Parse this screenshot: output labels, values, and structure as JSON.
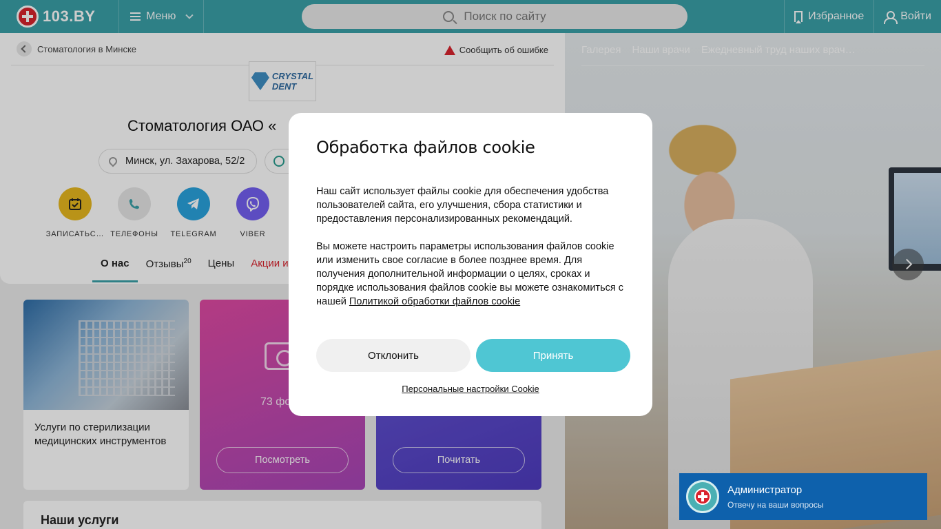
{
  "header": {
    "logo_text": "103.BY",
    "menu_label": "Меню",
    "search_placeholder": "Поиск по сайту",
    "favorites_label": "Избранное",
    "login_label": "Войти"
  },
  "breadcrumb": {
    "label": "Стоматология в Минске"
  },
  "report_error": {
    "label": "Сообщить об ошибке"
  },
  "clinic": {
    "logo_line1": "CRYSTAL",
    "logo_line2": "DENT",
    "title": "Стоматология ОАО «",
    "address": "Минск, ул. Захарова, 52/2"
  },
  "actions": [
    {
      "label": "ЗАПИСАТЬС…",
      "icon": "calendar-icon",
      "color": "#e8b81e"
    },
    {
      "label": "ТЕЛЕФОНЫ",
      "icon": "phone-icon",
      "color": "#e6e6e6"
    },
    {
      "label": "TELEGRAM",
      "icon": "telegram-icon",
      "color": "#2aa3de"
    },
    {
      "label": "VIBER",
      "icon": "viber-icon",
      "color": "#7360f2"
    }
  ],
  "tabs": [
    {
      "label": "О нас"
    },
    {
      "label": "Отзывы",
      "count": "20"
    },
    {
      "label": "Цены"
    },
    {
      "label": "Акции и"
    }
  ],
  "cards": {
    "sterilization_text": "Услуги по стерилизации медицинских инструментов",
    "photos_count": "73 фо",
    "view_button": "Посмотреть",
    "read_button": "Почитать"
  },
  "services_title": "Наши услуги",
  "gallery": {
    "nav": [
      "Галерея",
      "Наши врачи",
      "Ежедневный труд наших врач…"
    ]
  },
  "cookie_modal": {
    "title": "Обработка файлов cookie",
    "paragraph1": "Наш сайт использует файлы cookie для обеспечения удобства пользователей сайта, его улучшения, сбора статистики и предоставления персонализированных рекомендаций.",
    "paragraph2": "Вы можете настроить параметры использования файлов cookie или изменить свое согласие в более позднее время. Для получения дополнительной информации о целях, сроках и порядке использования файлов cookie вы можете ознакомиться с нашей",
    "policy_link": "Политикой обработки файлов cookie",
    "decline_label": "Отклонить",
    "accept_label": "Принять",
    "settings_link": "Персональные настройки Cookie",
    "accent_color": "#4fc6d3"
  },
  "chat": {
    "name": "Администратор",
    "subtitle": "Отвечу на ваши вопросы"
  }
}
